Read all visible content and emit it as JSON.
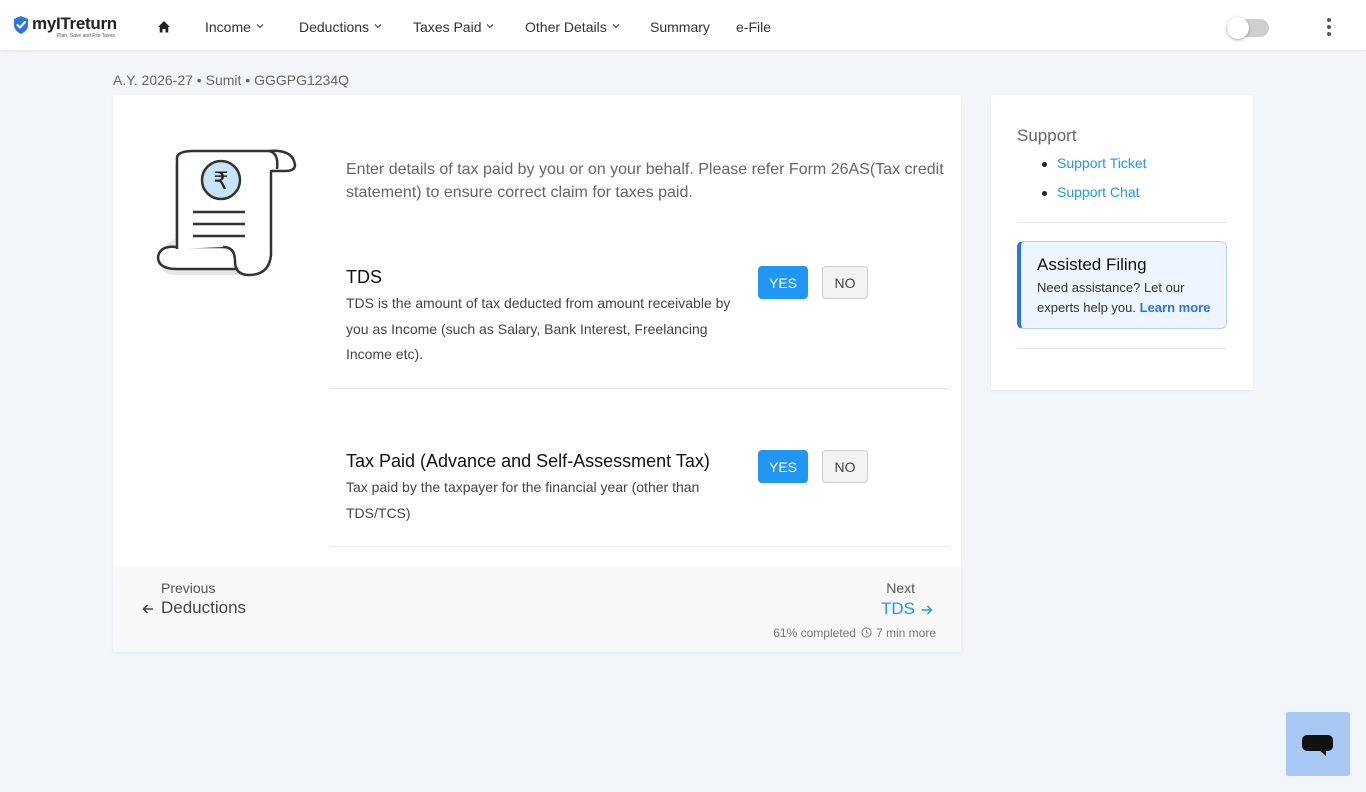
{
  "brand": {
    "name": "myITreturn",
    "tagline": "Plan, Save and File Taxes",
    "color": "#2196f3"
  },
  "nav": {
    "home_icon": "home-icon",
    "items": [
      {
        "label": "Income",
        "dropdown": true
      },
      {
        "label": "Deductions",
        "dropdown": true
      },
      {
        "label": "Taxes Paid",
        "dropdown": true
      },
      {
        "label": "Other Details",
        "dropdown": true
      },
      {
        "label": "Summary",
        "dropdown": false
      },
      {
        "label": "e-File",
        "dropdown": false
      }
    ],
    "toggle_state": "off",
    "menu_icon": "more-vertical-icon"
  },
  "breadcrumb": "A.Y. 2026-27 • Sumit • GGGPG1234Q",
  "main": {
    "illustration_icon": "rupee-receipt-scroll-icon",
    "intro": "Enter details of tax paid by you or on your behalf. Please refer Form 26AS(Tax credit statement) to ensure correct claim for taxes paid.",
    "sections": [
      {
        "title": "TDS",
        "description": "TDS is the amount of tax deducted from amount receivable by you as Income (such as Salary, Bank Interest, Freelancing Income etc).",
        "yes_label": "YES",
        "no_label": "NO",
        "selected": "YES"
      },
      {
        "title": "Tax Paid (Advance and Self-Assessment Tax)",
        "description": "Tax paid by the taxpayer for the financial year (other than TDS/TCS)",
        "yes_label": "YES",
        "no_label": "NO",
        "selected": "YES"
      }
    ],
    "footer": {
      "previous_label": "Previous",
      "previous_link": "Deductions",
      "next_label": "Next",
      "next_link": "TDS",
      "progress_text": "61% completed",
      "time_text": "7 min more",
      "percent_complete": 61
    }
  },
  "sidebar": {
    "support_title": "Support",
    "links": [
      "Support Ticket",
      "Support Chat"
    ],
    "assisted": {
      "title": "Assisted Filing",
      "text": "Need assistance? Let our experts help you.",
      "link": "Learn more"
    }
  },
  "chat_widget": {
    "icon": "chat-bubble-icon"
  }
}
